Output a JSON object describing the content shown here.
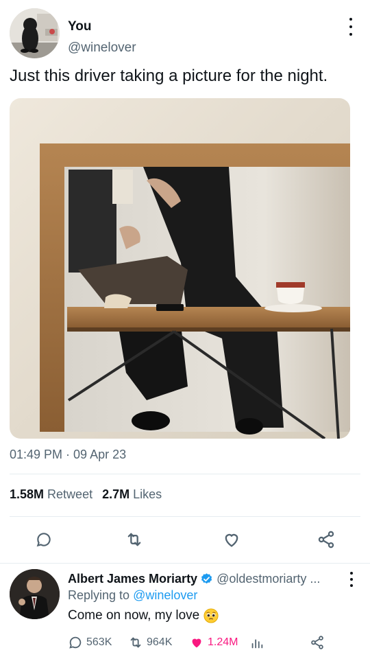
{
  "tweet": {
    "display_name": "You",
    "handle": "@winelover",
    "text": "Just this driver taking a picture for the night.",
    "timestamp": "01:49 PM · 09 Apr 23",
    "retweets_count": "1.58M",
    "retweets_label": "Retweet",
    "likes_count": "2.7M",
    "likes_label": "Likes",
    "media_description": "mirror photo of couple at a wooden table"
  },
  "reply": {
    "display_name": "Albert James Moriarty",
    "handle": "@oldestmoriarty ...",
    "replying_prefix": "Replying to",
    "replying_to": "@winelover",
    "text": "Come on now, my love",
    "replies": "563K",
    "retweets": "964K",
    "likes": "1.24M"
  },
  "icons": {
    "reply": "reply-icon",
    "retweet": "retweet-icon",
    "like": "heart-icon",
    "share": "share-icon",
    "analytics": "analytics-icon",
    "more": "more-icon",
    "verified": "verified-badge-icon"
  },
  "colors": {
    "accent": "#1d9bf0",
    "text_primary": "#0f1419",
    "text_secondary": "#536471",
    "like": "#f91880"
  }
}
